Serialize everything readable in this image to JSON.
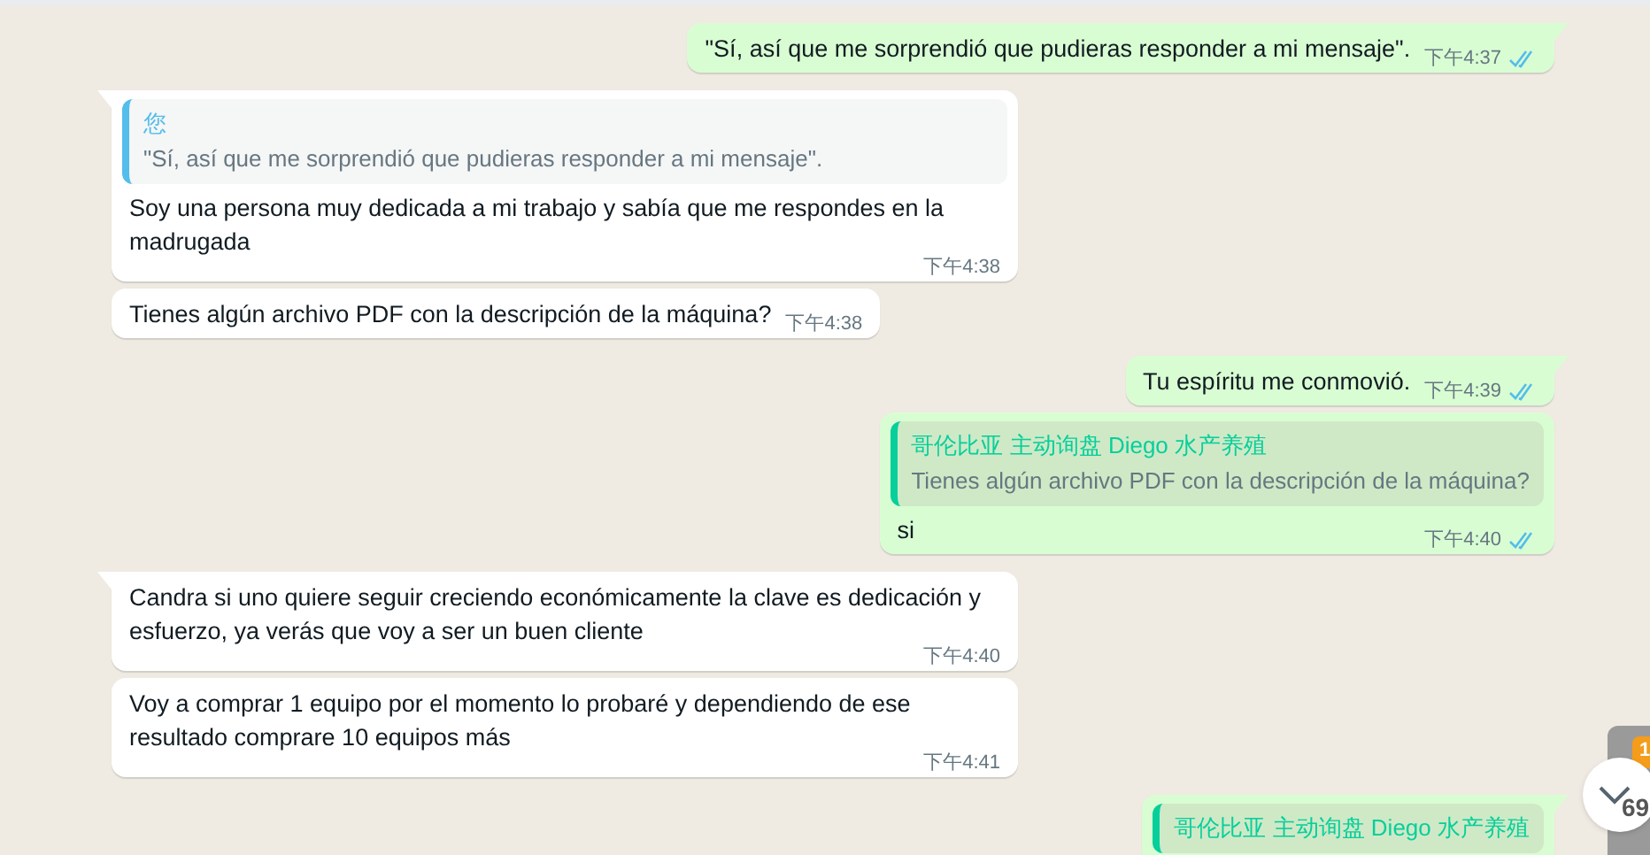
{
  "messages": [
    {
      "kind": "outgoing",
      "tail": true,
      "text": "\"Sí, así que me sorprendió que pudieras responder a mi mensaje\".",
      "time": "下午4:37",
      "read": true
    },
    {
      "kind": "incoming",
      "tail": true,
      "quote": {
        "author": "您",
        "color": "#53bdeb",
        "text": "\"Sí, así que me sorprendió que pudieras responder a mi mensaje\"."
      },
      "text": "Soy una persona muy dedicada a mi trabajo y sabía que me respondes en la madrugada",
      "time": "下午4:38"
    },
    {
      "kind": "incoming",
      "tail": false,
      "text": "Tienes algún archivo PDF con la descripción de la máquina?",
      "time": "下午4:38"
    },
    {
      "kind": "outgoing",
      "tail": true,
      "text": "Tu espíritu me conmovió.",
      "time": "下午4:39",
      "read": true
    },
    {
      "kind": "outgoing",
      "tail": false,
      "quote": {
        "author": "哥伦比亚 主动询盘 Diego 水产养殖",
        "color": "#06cf9c",
        "text": "Tienes algún archivo PDF con la descripción de la máquina?"
      },
      "text": "si",
      "time": "下午4:40",
      "read": true
    },
    {
      "kind": "incoming",
      "tail": true,
      "text": "Candra si uno quiere seguir creciendo económicamente la clave es dedicación y esfuerzo, ya verás que voy a ser un buen cliente",
      "time": "下午4:40"
    },
    {
      "kind": "incoming",
      "tail": false,
      "text": "Voy a comprar 1 equipo por el momento lo probaré y dependiendo de ese resultado comprare 10 equipos más",
      "time": "下午4:41"
    },
    {
      "kind": "outgoing",
      "tail": true,
      "quote": {
        "author": "哥伦比亚 主动询盘 Diego 水产养殖",
        "color": "#06cf9c"
      }
    }
  ],
  "side_widget": {
    "badge": "1",
    "count": "69"
  }
}
